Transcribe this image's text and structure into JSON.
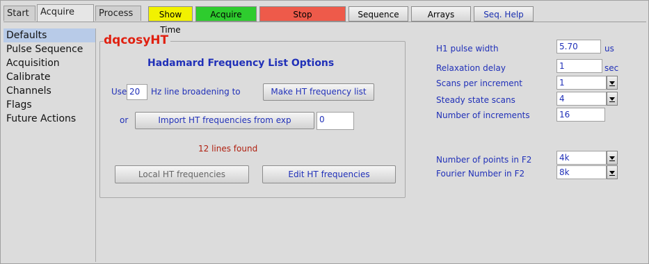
{
  "tabs": [
    "Start",
    "Acquire",
    "Process"
  ],
  "toolbar": {
    "show_time": "Show Time",
    "acquire": "Acquire",
    "stop": "Stop",
    "sequence": "Sequence",
    "arrays": "Arrays",
    "seq_help": "Seq. Help"
  },
  "colors": {
    "show_time": "#f2f200",
    "acquire": "#2ecc2e",
    "stop": "#ee5a4a",
    "title": "#e02010",
    "link": "#2030b8"
  },
  "sidebar": [
    "Defaults",
    "Pulse Sequence",
    "Acquisition",
    "Calibrate",
    "Channels",
    "Flags",
    "Future Actions"
  ],
  "panel": {
    "title": "dqcosyHT",
    "heading": "Hadamard Frequency List Options",
    "use_label": "Use",
    "broadening_value": "20",
    "broadening_suffix": "Hz line broadening to",
    "make_button": "Make HT frequency list",
    "or_label": "or",
    "import_button": "Import HT frequencies from exp",
    "exp_value": "0",
    "lines_found": "12 lines found",
    "local_button": "Local HT frequencies",
    "edit_button": "Edit HT frequencies"
  },
  "params": {
    "h1_pw_label": "H1 pulse width",
    "h1_pw_value": "5.70",
    "h1_pw_unit": "us",
    "relax_label": "Relaxation delay",
    "relax_value": "1",
    "relax_unit": "sec",
    "scans_label": "Scans per increment",
    "scans_value": "1",
    "ss_label": "Steady state scans",
    "ss_value": "4",
    "ni_label": "Number of increments",
    "ni_value": "16",
    "np_label": "Number of points in F2",
    "np_value": "4k",
    "fn_label": "Fourier Number in F2",
    "fn_value": "8k"
  }
}
